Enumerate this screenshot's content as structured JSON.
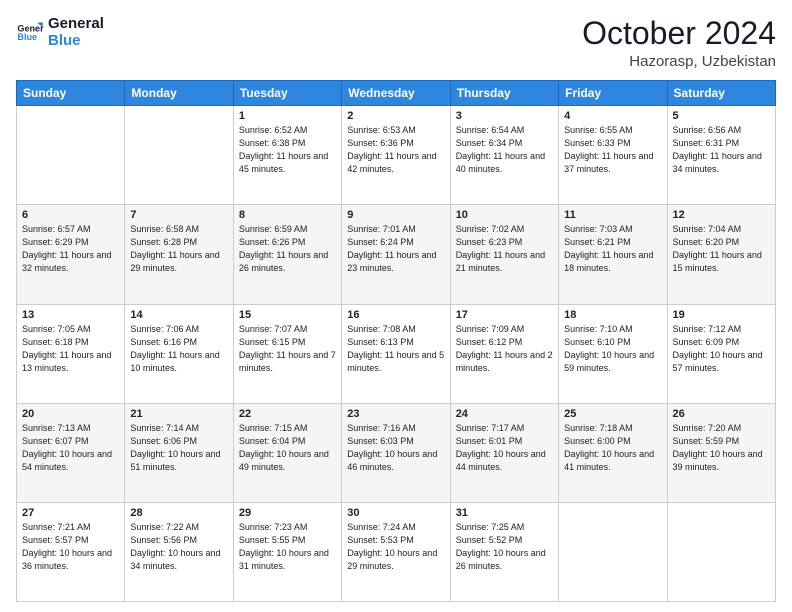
{
  "header": {
    "logo_general": "General",
    "logo_blue": "Blue",
    "month": "October 2024",
    "location": "Hazorasp, Uzbekistan"
  },
  "weekdays": [
    "Sunday",
    "Monday",
    "Tuesday",
    "Wednesday",
    "Thursday",
    "Friday",
    "Saturday"
  ],
  "weeks": [
    [
      null,
      null,
      {
        "day": "1",
        "sunrise": "6:52 AM",
        "sunset": "6:38 PM",
        "daylight": "11 hours and 45 minutes."
      },
      {
        "day": "2",
        "sunrise": "6:53 AM",
        "sunset": "6:36 PM",
        "daylight": "11 hours and 42 minutes."
      },
      {
        "day": "3",
        "sunrise": "6:54 AM",
        "sunset": "6:34 PM",
        "daylight": "11 hours and 40 minutes."
      },
      {
        "day": "4",
        "sunrise": "6:55 AM",
        "sunset": "6:33 PM",
        "daylight": "11 hours and 37 minutes."
      },
      {
        "day": "5",
        "sunrise": "6:56 AM",
        "sunset": "6:31 PM",
        "daylight": "11 hours and 34 minutes."
      }
    ],
    [
      {
        "day": "6",
        "sunrise": "6:57 AM",
        "sunset": "6:29 PM",
        "daylight": "11 hours and 32 minutes."
      },
      {
        "day": "7",
        "sunrise": "6:58 AM",
        "sunset": "6:28 PM",
        "daylight": "11 hours and 29 minutes."
      },
      {
        "day": "8",
        "sunrise": "6:59 AM",
        "sunset": "6:26 PM",
        "daylight": "11 hours and 26 minutes."
      },
      {
        "day": "9",
        "sunrise": "7:01 AM",
        "sunset": "6:24 PM",
        "daylight": "11 hours and 23 minutes."
      },
      {
        "day": "10",
        "sunrise": "7:02 AM",
        "sunset": "6:23 PM",
        "daylight": "11 hours and 21 minutes."
      },
      {
        "day": "11",
        "sunrise": "7:03 AM",
        "sunset": "6:21 PM",
        "daylight": "11 hours and 18 minutes."
      },
      {
        "day": "12",
        "sunrise": "7:04 AM",
        "sunset": "6:20 PM",
        "daylight": "11 hours and 15 minutes."
      }
    ],
    [
      {
        "day": "13",
        "sunrise": "7:05 AM",
        "sunset": "6:18 PM",
        "daylight": "11 hours and 13 minutes."
      },
      {
        "day": "14",
        "sunrise": "7:06 AM",
        "sunset": "6:16 PM",
        "daylight": "11 hours and 10 minutes."
      },
      {
        "day": "15",
        "sunrise": "7:07 AM",
        "sunset": "6:15 PM",
        "daylight": "11 hours and 7 minutes."
      },
      {
        "day": "16",
        "sunrise": "7:08 AM",
        "sunset": "6:13 PM",
        "daylight": "11 hours and 5 minutes."
      },
      {
        "day": "17",
        "sunrise": "7:09 AM",
        "sunset": "6:12 PM",
        "daylight": "11 hours and 2 minutes."
      },
      {
        "day": "18",
        "sunrise": "7:10 AM",
        "sunset": "6:10 PM",
        "daylight": "10 hours and 59 minutes."
      },
      {
        "day": "19",
        "sunrise": "7:12 AM",
        "sunset": "6:09 PM",
        "daylight": "10 hours and 57 minutes."
      }
    ],
    [
      {
        "day": "20",
        "sunrise": "7:13 AM",
        "sunset": "6:07 PM",
        "daylight": "10 hours and 54 minutes."
      },
      {
        "day": "21",
        "sunrise": "7:14 AM",
        "sunset": "6:06 PM",
        "daylight": "10 hours and 51 minutes."
      },
      {
        "day": "22",
        "sunrise": "7:15 AM",
        "sunset": "6:04 PM",
        "daylight": "10 hours and 49 minutes."
      },
      {
        "day": "23",
        "sunrise": "7:16 AM",
        "sunset": "6:03 PM",
        "daylight": "10 hours and 46 minutes."
      },
      {
        "day": "24",
        "sunrise": "7:17 AM",
        "sunset": "6:01 PM",
        "daylight": "10 hours and 44 minutes."
      },
      {
        "day": "25",
        "sunrise": "7:18 AM",
        "sunset": "6:00 PM",
        "daylight": "10 hours and 41 minutes."
      },
      {
        "day": "26",
        "sunrise": "7:20 AM",
        "sunset": "5:59 PM",
        "daylight": "10 hours and 39 minutes."
      }
    ],
    [
      {
        "day": "27",
        "sunrise": "7:21 AM",
        "sunset": "5:57 PM",
        "daylight": "10 hours and 36 minutes."
      },
      {
        "day": "28",
        "sunrise": "7:22 AM",
        "sunset": "5:56 PM",
        "daylight": "10 hours and 34 minutes."
      },
      {
        "day": "29",
        "sunrise": "7:23 AM",
        "sunset": "5:55 PM",
        "daylight": "10 hours and 31 minutes."
      },
      {
        "day": "30",
        "sunrise": "7:24 AM",
        "sunset": "5:53 PM",
        "daylight": "10 hours and 29 minutes."
      },
      {
        "day": "31",
        "sunrise": "7:25 AM",
        "sunset": "5:52 PM",
        "daylight": "10 hours and 26 minutes."
      },
      null,
      null
    ]
  ],
  "labels": {
    "sunrise": "Sunrise:",
    "sunset": "Sunset:",
    "daylight": "Daylight:"
  }
}
